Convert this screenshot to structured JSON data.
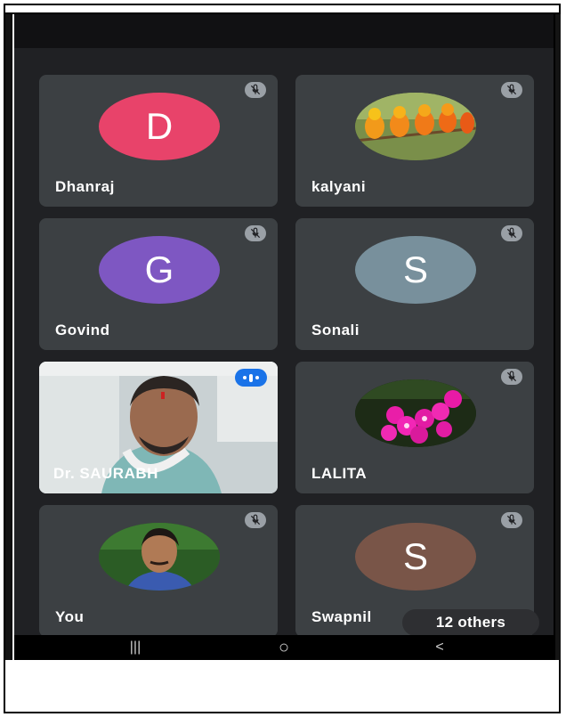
{
  "participants": [
    {
      "name": "Dhanraj",
      "initial": "D",
      "avatar_color": "#e8436a",
      "avatar_type": "letter",
      "muted": true
    },
    {
      "name": "kalyani",
      "initial": "",
      "avatar_type": "photo-parrots",
      "muted": true
    },
    {
      "name": "Govind",
      "initial": "G",
      "avatar_color": "#7e57c2",
      "avatar_type": "letter",
      "muted": true
    },
    {
      "name": "Sonali",
      "initial": "S",
      "avatar_color": "#78909c",
      "avatar_type": "letter",
      "muted": true
    },
    {
      "name": "Dr. SAURABH",
      "initial": "",
      "avatar_type": "live-video",
      "muted": false,
      "speaking": true
    },
    {
      "name": "LALITA",
      "initial": "",
      "avatar_type": "photo-orchids",
      "muted": true
    },
    {
      "name": "You",
      "initial": "",
      "avatar_type": "photo-man",
      "muted": true
    },
    {
      "name": "Swapnil",
      "initial": "S",
      "avatar_color": "#795548",
      "avatar_type": "letter",
      "muted": true
    }
  ],
  "others_label": "12 others",
  "nav": {
    "recents": "|||",
    "home": "○",
    "back": "<"
  },
  "icons": [
    "mic-off-icon",
    "speaking-indicator-icon"
  ],
  "colors": {
    "background": "#202124",
    "tile": "#3c4043",
    "accent": "#1a73e8"
  }
}
